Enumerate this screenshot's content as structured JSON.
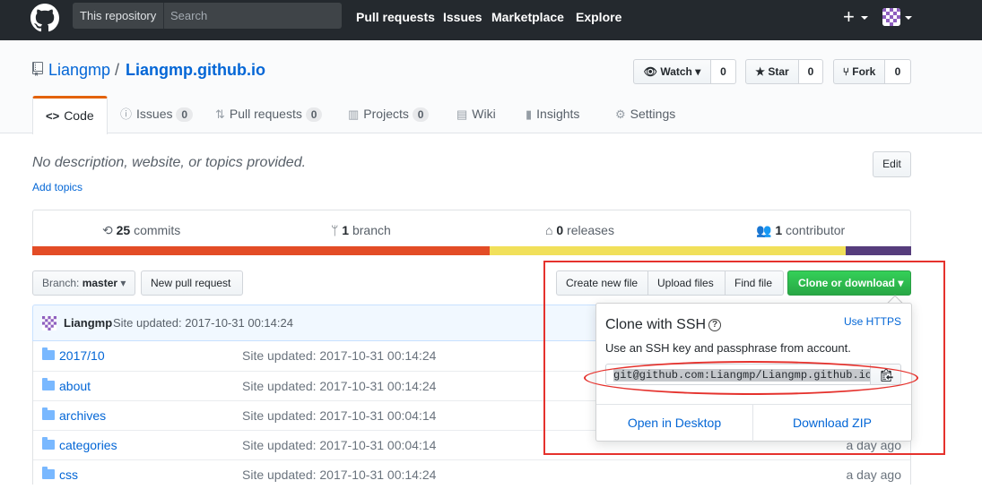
{
  "header": {
    "scope_label": "This repository",
    "search_placeholder": "Search",
    "nav": [
      "Pull requests",
      "Issues",
      "Marketplace",
      "Explore"
    ]
  },
  "repo": {
    "owner": "Liangmp",
    "separator": "/",
    "name": "Liangmp.github.io",
    "watch_label": "Watch",
    "watch_count": "0",
    "star_label": "Star",
    "star_count": "0",
    "fork_label": "Fork",
    "fork_count": "0"
  },
  "tabs": [
    {
      "label": "Code",
      "icon": "code-icon"
    },
    {
      "label": "Issues",
      "count": "0",
      "icon": "issue-icon"
    },
    {
      "label": "Pull requests",
      "count": "0",
      "icon": "pull-request-icon"
    },
    {
      "label": "Projects",
      "count": "0",
      "icon": "project-icon"
    },
    {
      "label": "Wiki",
      "icon": "wiki-icon"
    },
    {
      "label": "Insights",
      "icon": "graph-icon"
    },
    {
      "label": "Settings",
      "icon": "gear-icon"
    }
  ],
  "description": "No description, website, or topics provided.",
  "add_topics": "Add topics",
  "edit_label": "Edit",
  "summary": {
    "commits_num": "25",
    "commits_label": "commits",
    "branch_num": "1",
    "branch_label": "branch",
    "releases_num": "0",
    "releases_label": "releases",
    "contrib_num": "1",
    "contrib_label": "contributor"
  },
  "lang_colors": [
    "#e34c26",
    "#f1e05a",
    "#563d7c"
  ],
  "file_nav": {
    "branch_prefix": "Branch:",
    "branch_name": "master",
    "new_pr": "New pull request",
    "create_file": "Create new file",
    "upload_files": "Upload files",
    "find_file": "Find file",
    "clone": "Clone or download"
  },
  "latest_commit": {
    "author": "Liangmp",
    "message": "Site updated: 2017-10-31 00:14:24"
  },
  "files": [
    {
      "name": "2017/10",
      "message": "Site updated: 2017-10-31 00:14:24",
      "age": ""
    },
    {
      "name": "about",
      "message": "Site updated: 2017-10-31 00:14:24",
      "age": ""
    },
    {
      "name": "archives",
      "message": "Site updated: 2017-10-31 00:04:14",
      "age": ""
    },
    {
      "name": "categories",
      "message": "Site updated: 2017-10-31 00:04:14",
      "age": "a day ago"
    },
    {
      "name": "css",
      "message": "Site updated: 2017-10-31 00:14:24",
      "age": "a day ago"
    }
  ],
  "clone_dropdown": {
    "title": "Clone with SSH",
    "use_https": "Use HTTPS",
    "subtitle": "Use an SSH key and passphrase from account.",
    "url": "git@github.com:Liangmp/Liangmp.github.io.g",
    "open_desktop": "Open in Desktop",
    "download_zip": "Download ZIP"
  },
  "colors": {
    "header_bg": "#24292e",
    "link": "#0366d6",
    "green": "#28a745",
    "tab_accent": "#e36209",
    "annotation_red": "#e5322d"
  }
}
